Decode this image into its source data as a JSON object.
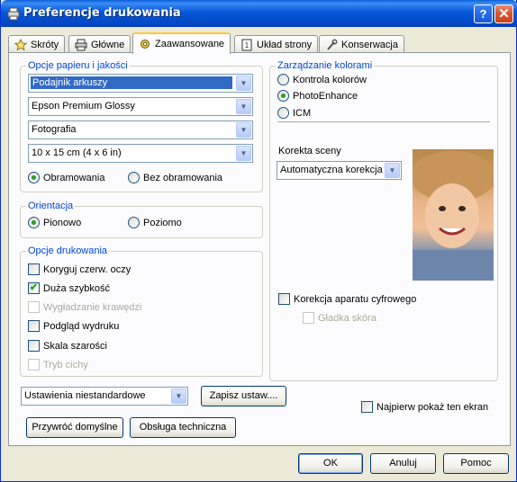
{
  "window": {
    "title": "Preferencje drukowania",
    "help_label": "?",
    "close_label": "✕"
  },
  "tabs": [
    {
      "label": "Skróty",
      "icon": "star-icon"
    },
    {
      "label": "Główne",
      "icon": "printer-icon"
    },
    {
      "label": "Zaawansowane",
      "icon": "gear-icon",
      "active": true
    },
    {
      "label": "Układ strony",
      "icon": "page-icon"
    },
    {
      "label": "Konserwacja",
      "icon": "wrench-icon"
    }
  ],
  "paper": {
    "title": "Opcje papieru i jakości",
    "source": "Podajnik arkuszy",
    "media": "Epson Premium Glossy",
    "quality": "Fotografia",
    "size": "10 x 15 cm (4 x 6 in)",
    "border_label": "Obramowania",
    "borderless_label": "Bez obramowania",
    "border_selected": "Obramowania"
  },
  "orientation": {
    "title": "Orientacja",
    "portrait_label": "Pionowo",
    "landscape_label": "Poziomo",
    "selected": "Pionowo"
  },
  "print_options": {
    "title": "Opcje drukowania",
    "items": [
      {
        "label": "Koryguj czerw. oczy",
        "checked": false,
        "enabled": true
      },
      {
        "label": "Duża szybkość",
        "checked": true,
        "enabled": true
      },
      {
        "label": "Wygładzanie krawędzi",
        "checked": false,
        "enabled": false
      },
      {
        "label": "Podgląd wydruku",
        "checked": false,
        "enabled": true
      },
      {
        "label": "Skala szarości",
        "checked": false,
        "enabled": true
      },
      {
        "label": "Tryb cichy",
        "checked": false,
        "enabled": false
      }
    ]
  },
  "color": {
    "title": "Zarządzanie kolorami",
    "options": [
      "Kontrola kolorów",
      "PhotoEnhance",
      "ICM"
    ],
    "selected": "PhotoEnhance",
    "scene_label": "Korekta sceny",
    "scene_value": "Automatyczna korekcja",
    "digital_camera_label": "Korekcja aparatu cyfrowego",
    "smooth_skin_label": "Gładka skóra"
  },
  "bottom": {
    "custom_settings": "Ustawienia niestandardowe",
    "save_settings": "Zapisz ustaw....",
    "show_first": "Najpierw pokaż ten ekran",
    "restore_defaults": "Przywróć domyślne",
    "tech_support": "Obsługa techniczna"
  },
  "footer": {
    "ok": "OK",
    "cancel": "Anuluj",
    "help": "Pomoc"
  }
}
